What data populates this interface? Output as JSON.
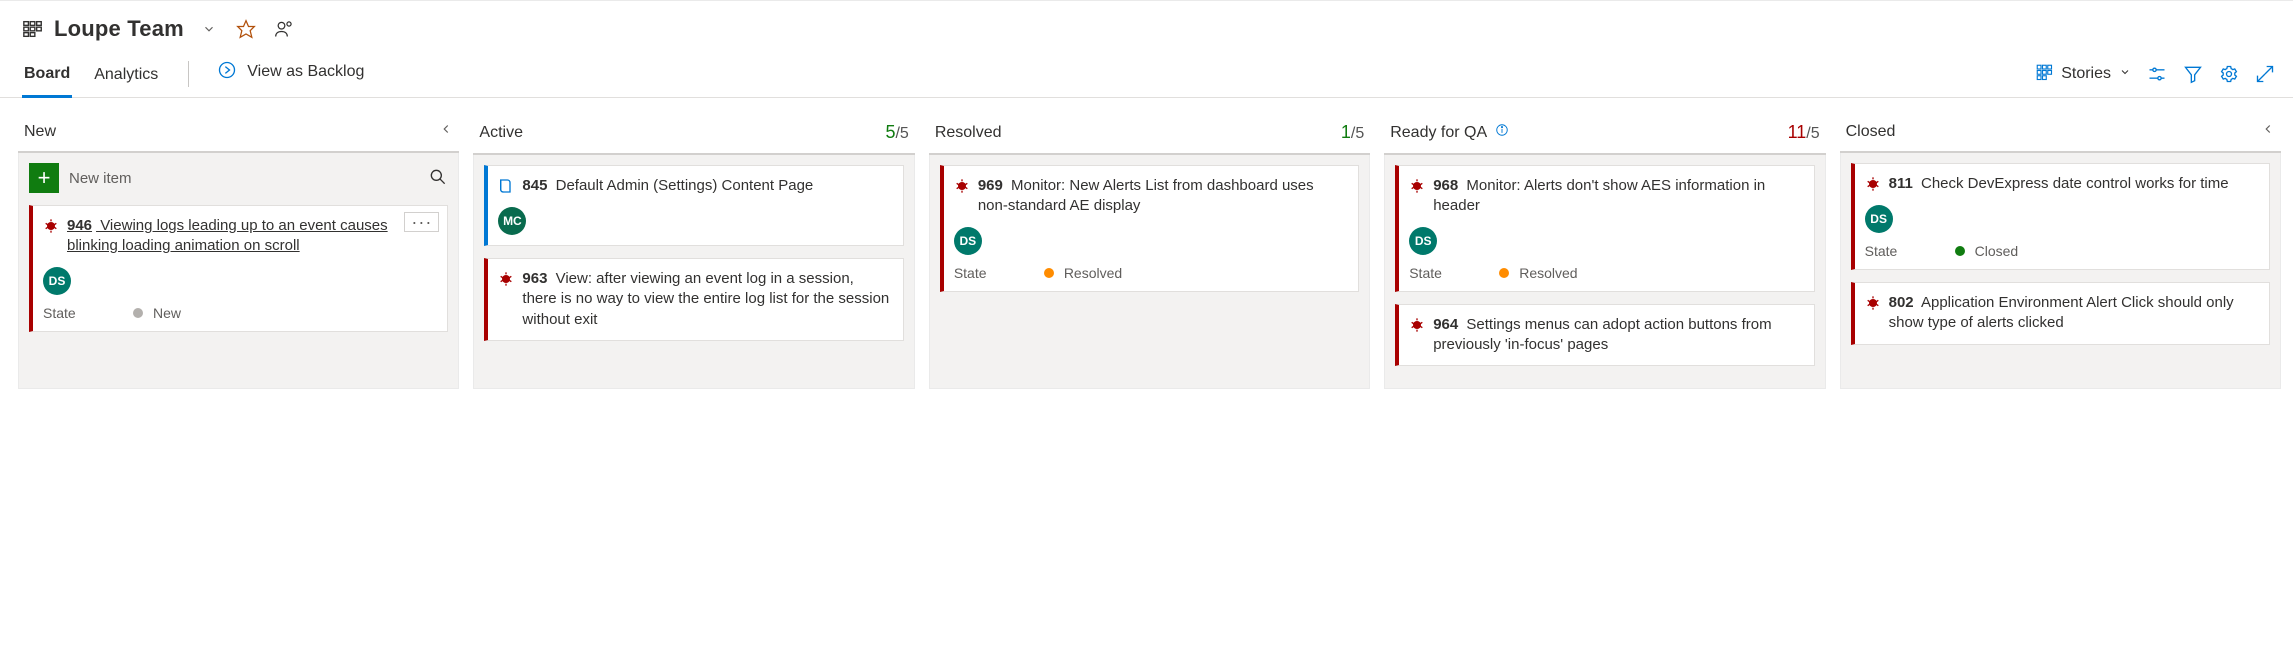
{
  "header": {
    "team_name": "Loupe Team"
  },
  "tabs": {
    "board": "Board",
    "analytics": "Analytics",
    "view_as_backlog": "View as Backlog",
    "stories_label": "Stories"
  },
  "columns": [
    {
      "title": "New",
      "wip_current": null,
      "wip_limit": null,
      "collapsible": true,
      "has_new_item": true,
      "new_item_label": "New item",
      "cards": [
        {
          "type": "bug",
          "id": "946",
          "title": "Viewing logs leading up to an event causes blinking loading animation on scroll",
          "underlined": true,
          "show_more": true,
          "avatar": "DS",
          "state_label": "State",
          "state_value": "New",
          "state_kind": "new"
        }
      ]
    },
    {
      "title": "Active",
      "wip_current": "5",
      "wip_limit": "5",
      "wip_over": false,
      "cards": [
        {
          "type": "story",
          "id": "845",
          "title": "Default Admin (Settings) Content Page",
          "avatar": "MC",
          "avatar_class": "mc"
        },
        {
          "type": "bug",
          "id": "963",
          "title": "View: after viewing an event log in a session, there is no way to view the entire log list for the session without exit"
        }
      ]
    },
    {
      "title": "Resolved",
      "wip_current": "1",
      "wip_limit": "5",
      "wip_over": false,
      "cards": [
        {
          "type": "bug",
          "id": "969",
          "title": "Monitor: New Alerts List from dashboard uses non-standard AE display",
          "avatar": "DS",
          "state_label": "State",
          "state_value": "Resolved",
          "state_kind": "resolved"
        }
      ]
    },
    {
      "title": "Ready for QA",
      "has_info": true,
      "wip_current": "11",
      "wip_limit": "5",
      "wip_over": true,
      "cards": [
        {
          "type": "bug",
          "id": "968",
          "title": "Monitor: Alerts don't show AES information in header",
          "avatar": "DS",
          "state_label": "State",
          "state_value": "Resolved",
          "state_kind": "resolved"
        },
        {
          "type": "bug",
          "id": "964",
          "title": "Settings menus can adopt action buttons from previously 'in-focus' pages"
        }
      ]
    },
    {
      "title": "Closed",
      "collapsible": true,
      "cards": [
        {
          "type": "bug",
          "id": "811",
          "title": "Check DevExpress date control works for time",
          "avatar": "DS",
          "state_label": "State",
          "state_value": "Closed",
          "state_kind": "closed"
        },
        {
          "type": "bug",
          "id": "802",
          "title": "Application Environment Alert Click should only show type of alerts clicked"
        }
      ]
    }
  ]
}
